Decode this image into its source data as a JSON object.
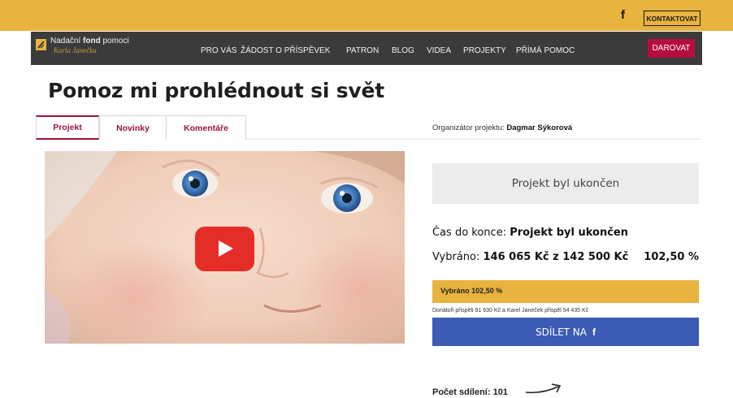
{
  "topbar": {
    "facebook_icon": "f",
    "contact_label": "KONTAKTOVAT",
    "color": "#e8b33e"
  },
  "navbar": {
    "logo_prefix": "Nadační ",
    "logo_bold": "fond",
    "logo_suffix": " pomoci",
    "logo_script": "Karla Janečka",
    "items": [
      {
        "label": "PRO VÁS"
      },
      {
        "label": "ŽÁDOST O PŘÍSPĚVEK"
      },
      {
        "label": "PATRON"
      },
      {
        "label": "BLOG"
      },
      {
        "label": "VIDEA"
      },
      {
        "label": "PROJEKTY"
      },
      {
        "label": "PŘÍMÁ POMOC"
      }
    ],
    "donate_label": "DAROVAT",
    "donate_color": "#b50e3c"
  },
  "page": {
    "title": "Pomoz mi prohlédnout si svět"
  },
  "tabs": [
    {
      "label": "Projekt",
      "active": true
    },
    {
      "label": "Novinky",
      "active": false
    },
    {
      "label": "Komentáře",
      "active": false
    }
  ],
  "organizer": {
    "label": "Organizátor projektu: ",
    "name": "Dagmar Sýkorová"
  },
  "video": {
    "play_icon": "youtube-play-icon"
  },
  "status": {
    "ended_text": "Projekt byl ukončen",
    "time_label": "Čas do konce: ",
    "time_value": "Projekt byl ukončen",
    "raised_label": "Vybráno: ",
    "raised_value": "146 065 Kč z 142 500 Kč",
    "percent": "102,50 %",
    "progress_fraction": 1.0,
    "progress_label": "Vybráno 102,50 %",
    "donors_note": "Donátoři přispěli 91 630 Kč a Karel Janeček přispěl 54 435 Kč"
  },
  "share": {
    "label": "SDÍLET NA",
    "icon": "f",
    "count_label": "Počet sdílení: 101"
  }
}
